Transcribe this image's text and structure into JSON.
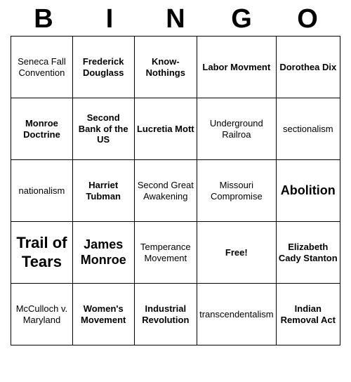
{
  "header": {
    "letters": [
      "B",
      "I",
      "N",
      "G",
      "O"
    ]
  },
  "grid": [
    [
      {
        "text": "Seneca Fall Convention",
        "size": "small"
      },
      {
        "text": "Frederick Douglass",
        "size": "medium"
      },
      {
        "text": "Know-Nothings",
        "size": "medium"
      },
      {
        "text": "Labor Movment",
        "size": "medium"
      },
      {
        "text": "Dorothea Dix",
        "size": "medium"
      }
    ],
    [
      {
        "text": "Monroe Doctrine",
        "size": "medium"
      },
      {
        "text": "Second Bank of the US",
        "size": "medium"
      },
      {
        "text": "Lucretia Mott",
        "size": "medium"
      },
      {
        "text": "Underground Railroa",
        "size": "small"
      },
      {
        "text": "sectionalism",
        "size": "small"
      }
    ],
    [
      {
        "text": "nationalism",
        "size": "small"
      },
      {
        "text": "Harriet Tubman",
        "size": "medium"
      },
      {
        "text": "Second Great Awakening",
        "size": "small"
      },
      {
        "text": "Missouri Compromise",
        "size": "small"
      },
      {
        "text": "Abolition",
        "size": "large"
      }
    ],
    [
      {
        "text": "Trail of Tears",
        "size": "xlarge"
      },
      {
        "text": "James Monroe",
        "size": "large"
      },
      {
        "text": "Temperance Movement",
        "size": "small"
      },
      {
        "text": "Free!",
        "size": "free"
      },
      {
        "text": "Elizabeth Cady Stanton",
        "size": "medium"
      }
    ],
    [
      {
        "text": "McCulloch v. Maryland",
        "size": "small"
      },
      {
        "text": "Women's Movement",
        "size": "medium"
      },
      {
        "text": "Industrial Revolution",
        "size": "medium"
      },
      {
        "text": "transcendentalism",
        "size": "xsmall"
      },
      {
        "text": "Indian Removal Act",
        "size": "medium"
      }
    ]
  ]
}
